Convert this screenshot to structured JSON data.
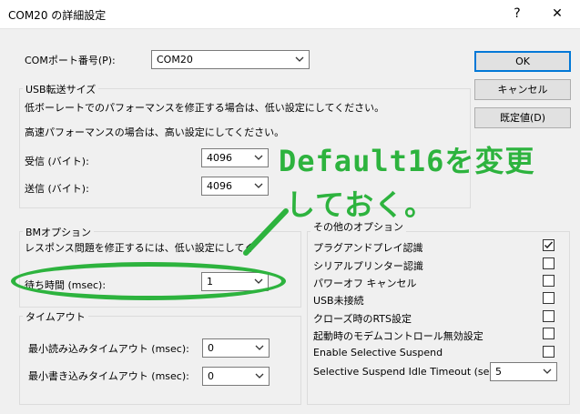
{
  "window": {
    "title": "COM20 の詳細設定",
    "help_glyph": "?",
    "close_glyph": "✕"
  },
  "port": {
    "label": "COMポート番号(P):",
    "value": "COM20"
  },
  "usb": {
    "legend": "USB転送サイズ",
    "desc1": "低ボーレートでのパフォーマンスを修正する場合は、低い設定にしてください。",
    "desc2": "高速パフォーマンスの場合は、高い設定にしてください。",
    "receive_label": "受信 (バイト):",
    "receive_value": "4096",
    "send_label": "送信 (バイト):",
    "send_value": "4096"
  },
  "bm": {
    "legend": "BMオプション",
    "desc": "レスポンス問題を修正するには、低い設定にしてくださ",
    "latency_label": "待ち時間 (msec):",
    "latency_value": "1"
  },
  "timeout": {
    "legend": "タイムアウト",
    "read_label": "最小読み込みタイムアウト (msec):",
    "read_value": "0",
    "write_label": "最小書き込みタイムアウト (msec):",
    "write_value": "0"
  },
  "buttons": {
    "ok": "OK",
    "cancel": "キャンセル",
    "defaults": "既定値(D)"
  },
  "misc": {
    "legend": "その他のオプション",
    "options": [
      {
        "label": "プラグアンドプレイ認識",
        "checked": true
      },
      {
        "label": "シリアルプリンター認識",
        "checked": false
      },
      {
        "label": "パワーオフ キャンセル",
        "checked": false
      },
      {
        "label": "USB未接続",
        "checked": false
      },
      {
        "label": "クローズ時のRTS設定",
        "checked": false
      },
      {
        "label": "起動時のモデムコントロール無効設定",
        "checked": false
      },
      {
        "label": "Enable Selective Suspend",
        "checked": false
      }
    ],
    "suspend_label": "Selective Suspend Idle Timeout (secs):",
    "suspend_value": "5"
  },
  "annotation": {
    "line1": "Default16を変更",
    "line2": "しておく。"
  },
  "colors": {
    "annotation": "#2db33e",
    "accent": "#0078d7"
  },
  "icons": {
    "dropdown": "chevron-down-icon",
    "check": "checkmark-icon"
  }
}
